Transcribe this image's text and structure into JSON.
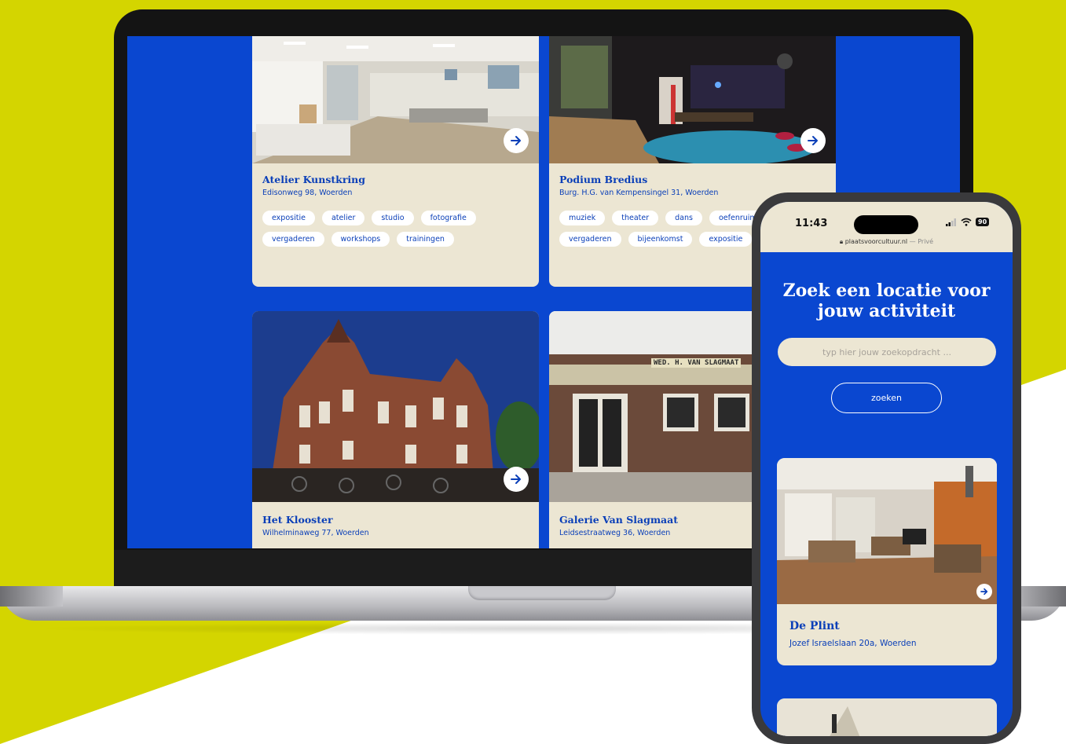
{
  "colors": {
    "brand_blue": "#0a47d0",
    "card_beige": "#ece6d3",
    "accent_yellow": "#d4d500"
  },
  "laptop": {
    "cards": [
      {
        "title": "Atelier Kunstkring",
        "address": "Edisonweg 98, Woerden",
        "tags": [
          "expositie",
          "atelier",
          "studio",
          "fotografie",
          "vergaderen",
          "workshops",
          "trainingen"
        ],
        "icon": "arrow-right-icon"
      },
      {
        "title": "Podium Bredius",
        "address": "Burg. H.G. van Kempensingel 31, Woerden",
        "tags": [
          "muziek",
          "theater",
          "dans",
          "oefenruimte",
          "vergaderen",
          "bijeenkomst",
          "expositie"
        ],
        "icon": "arrow-right-icon"
      },
      {
        "title": "Het Klooster",
        "address": "Wilhelminaweg 77, Woerden",
        "tags": [],
        "icon": "arrow-right-icon"
      },
      {
        "title": "Galerie Van Slagmaat",
        "address": "Leidsestraatweg 36, Woerden",
        "tags": [],
        "sign_text": "WED. H. VAN SLAGMAAT",
        "icon": "arrow-right-icon"
      }
    ]
  },
  "phone": {
    "status": {
      "time": "11:43",
      "battery": "90"
    },
    "url": {
      "domain": "plaatsvoorcultuur.nl",
      "mode": "— Privé"
    },
    "hero_title": "Zoek een locatie voor jouw activiteit",
    "search": {
      "placeholder": "typ hier jouw zoekopdracht ...",
      "button": "zoeken"
    },
    "card": {
      "title": "De Plint",
      "address": "Jozef Israelslaan 20a, Woerden"
    }
  }
}
